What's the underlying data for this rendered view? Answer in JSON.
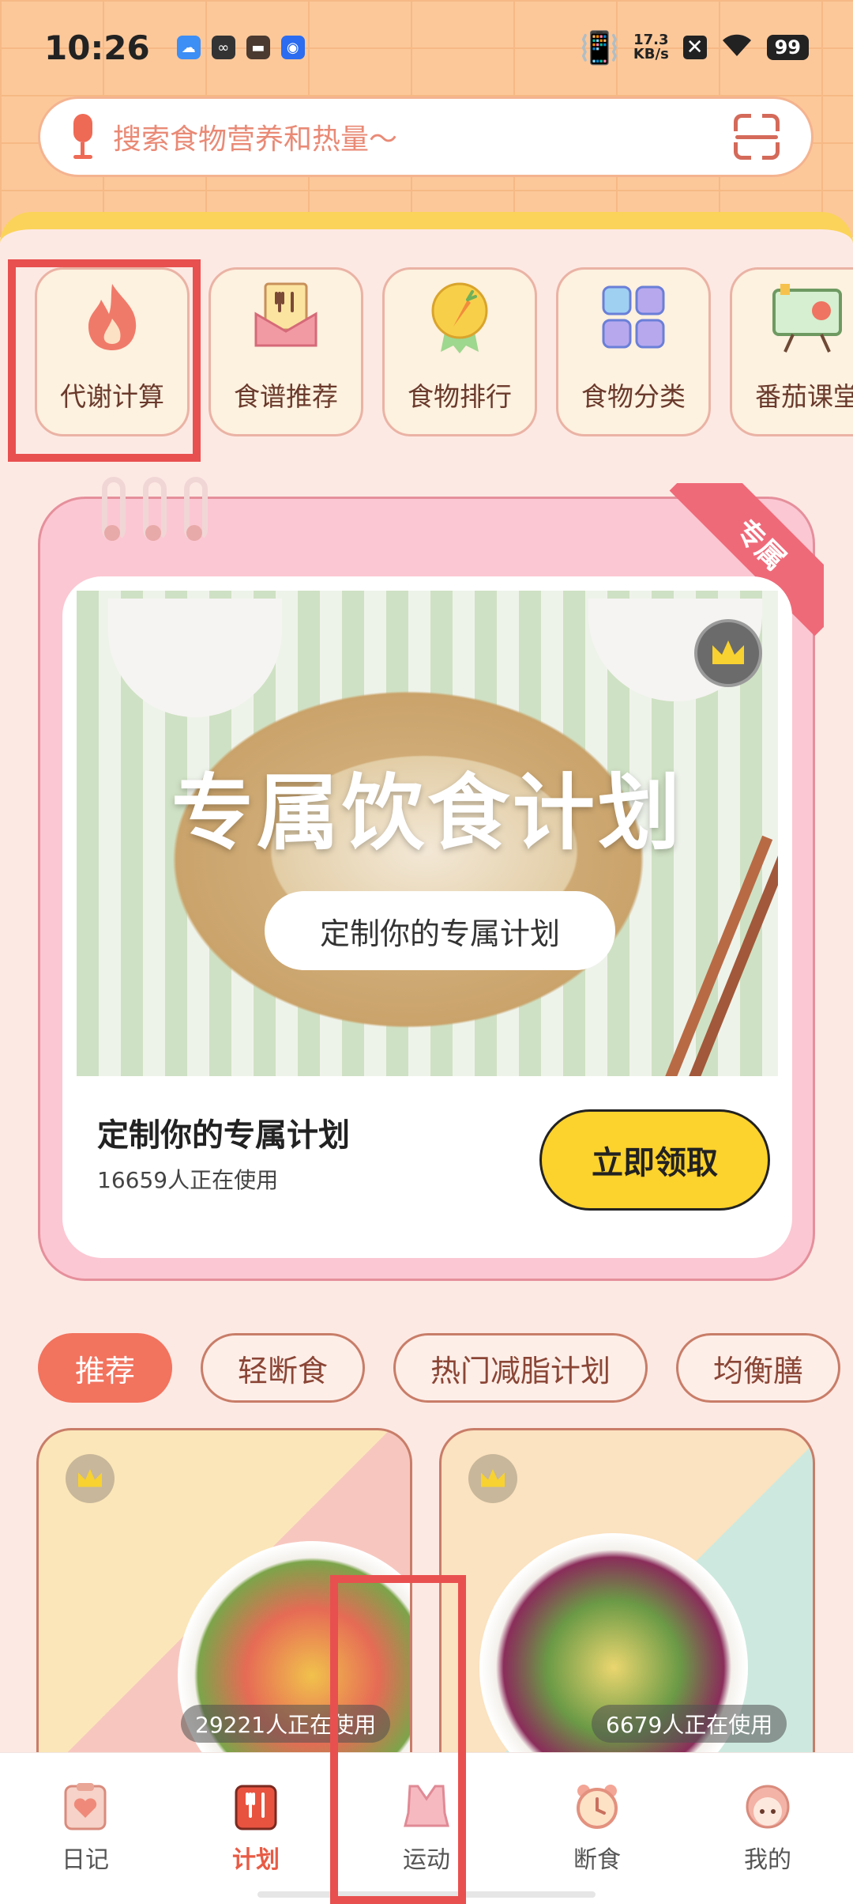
{
  "status_bar": {
    "time": "10:26",
    "net_speed_value": "17.3",
    "net_speed_unit": "KB/s",
    "battery": "99"
  },
  "search": {
    "placeholder": "搜索食物营养和热量～"
  },
  "quick_actions": [
    {
      "label": "代谢计算",
      "icon": "flame-icon"
    },
    {
      "label": "食谱推荐",
      "icon": "recipe-icon"
    },
    {
      "label": "食物排行",
      "icon": "medal-carrot-icon"
    },
    {
      "label": "食物分类",
      "icon": "grid-icon"
    },
    {
      "label": "番茄课堂",
      "icon": "board-icon"
    }
  ],
  "plan_card": {
    "ribbon": "专属",
    "photo_title": "专属饮食计划",
    "photo_button": "定制你的专属计划",
    "title": "定制你的专属计划",
    "users": "16659人正在使用",
    "claim_button": "立即领取"
  },
  "tabs": [
    {
      "label": "推荐",
      "active": true
    },
    {
      "label": "轻断食",
      "active": false
    },
    {
      "label": "热门减脂计划",
      "active": false
    },
    {
      "label": "均衡膳",
      "active": false
    }
  ],
  "recipes": [
    {
      "users": "29221人正在使用"
    },
    {
      "users": "6679人正在使用"
    }
  ],
  "bottom_nav": [
    {
      "label": "日记",
      "icon": "clipboard-heart-icon",
      "active": false
    },
    {
      "label": "计划",
      "icon": "menu-plan-icon",
      "active": true
    },
    {
      "label": "运动",
      "icon": "sports-bra-icon",
      "active": false
    },
    {
      "label": "断食",
      "icon": "alarm-clock-icon",
      "active": false
    },
    {
      "label": "我的",
      "icon": "avatar-icon",
      "active": false
    }
  ],
  "colors": {
    "accent": "#f2735e",
    "claim_button": "#fcd22c",
    "active_nav": "#e85b45",
    "highlight_box": "#e8504f"
  }
}
